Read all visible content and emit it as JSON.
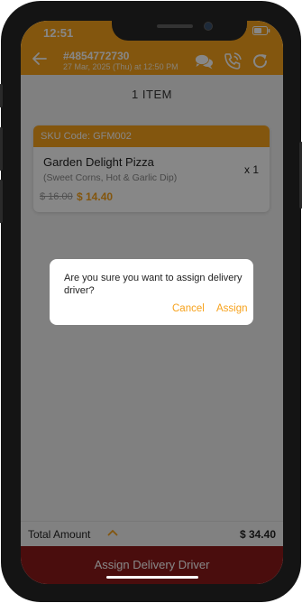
{
  "status_bar": {
    "time": "12:51"
  },
  "header": {
    "order_number": "#4854772730",
    "order_date": "27 Mar, 2025 (Thu) at 12:50 PM",
    "icons": [
      "back-arrow-icon",
      "chat-icon",
      "phone-call-icon",
      "refresh-icon"
    ]
  },
  "items_title": "1 ITEM",
  "item": {
    "sku_label": "SKU Code: GFM002",
    "name": "Garden Delight Pizza",
    "options": "(Sweet Corns, Hot & Garlic Dip)",
    "quantity": "x 1",
    "original_price": "$ 16.00",
    "price": "$ 14.40"
  },
  "total": {
    "label": "Total Amount",
    "value": "$ 34.40"
  },
  "assign_button": "Assign Delivery Driver",
  "dialog": {
    "message": "Are you sure you want to assign delivery driver?",
    "cancel": "Cancel",
    "confirm": "Assign"
  },
  "colors": {
    "accent": "#f7a21c",
    "primary_button": "#8d1a1a",
    "overlay": "rgba(0,0,0,0.47)"
  }
}
